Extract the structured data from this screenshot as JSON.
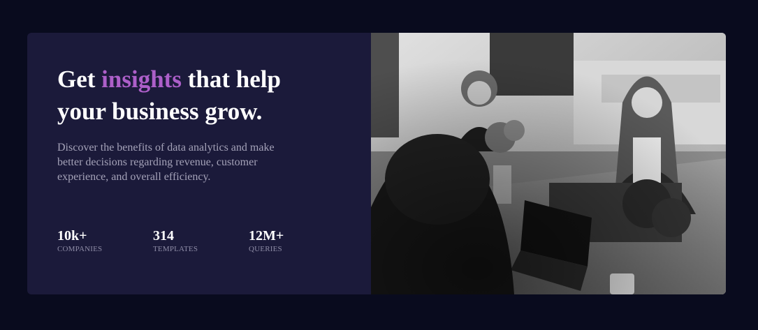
{
  "headline": {
    "prefix": "Get ",
    "accent": "insights",
    "suffix": " that help your business grow."
  },
  "description": "Discover the benefits of data analytics and make better decisions regarding revenue, customer experience, and overall efficiency.",
  "stats": [
    {
      "value": "10k+",
      "label": "COMPANIES"
    },
    {
      "value": "314",
      "label": "TEMPLATES"
    },
    {
      "value": "12M+",
      "label": "QUERIES"
    }
  ],
  "colors": {
    "page_background": "#090b1e",
    "card_background": "#1b1a3a",
    "accent": "#ad5fc9",
    "headline_text": "#ffffff",
    "body_text": "#a4a2b8",
    "stat_label_text": "#8e8ca6"
  }
}
